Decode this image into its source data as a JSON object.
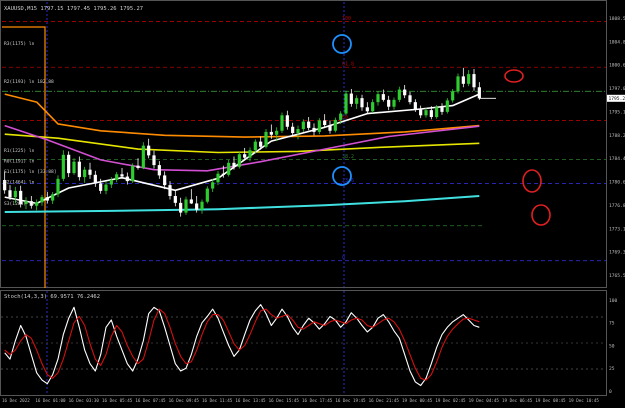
{
  "window": {
    "header_text": "XAUUSD,M15  1797.15 1797.45 1795.26 1795.27",
    "indicator_header": "Stoch(14,3,3) 69.9571 76.2462"
  },
  "colors": {
    "background": "#000000",
    "bull_candle": "#2ecc2e",
    "bear_candle": "#ffffff",
    "ema_orange": "#ff8c00",
    "ema_yellow": "#e6e600",
    "ema_pink": "#d24fd2",
    "ema_white": "#ffffff",
    "ema_cyan": "#40e0e0",
    "fib_red": "#b00000",
    "fib_green": "#2a7a2a",
    "fib_blue": "#2b2bcc",
    "stoch_main": "#ffffff",
    "stoch_signal": "#d41010",
    "annotation_blue": "#1e90ff",
    "annotation_red": "#e02020"
  },
  "chart_data": [
    {
      "type": "candlestick",
      "symbol": "XAUUSD",
      "timeframe": "M15",
      "ylim": [
        1763,
        1810
      ],
      "price_axis_labels": [
        "1808.56",
        "1804.88",
        "1800.65",
        "1797.04",
        "1795.12",
        "1788.21",
        "1784.44",
        "1780.65",
        "1776.88",
        "1773.11",
        "1769.34",
        "1765.57"
      ],
      "current_price": "1795.27",
      "time_labels": [
        "16 Dec 2022",
        "16 Dec 01:00",
        "16 Dec 03:30",
        "16 Dec 05:45",
        "16 Dec 07:45",
        "16 Dec 09:45",
        "16 Dec 11:45",
        "16 Dec 13:45",
        "16 Dec 15:45",
        "16 Dec 17:45",
        "16 Dec 19:45",
        "16 Dec 21:45",
        "19 Dec 00:45",
        "19 Dec 02:45",
        "19 Dec 04:45",
        "19 Dec 06:45",
        "19 Dec 08:45",
        "19 Dec 10:45"
      ],
      "candles": [
        [
          1781.0,
          1782.5,
          1778.6,
          1779.2
        ],
        [
          1779.2,
          1780.1,
          1777.5,
          1778.0
        ],
        [
          1778.0,
          1779.8,
          1776.9,
          1779.1
        ],
        [
          1779.1,
          1780.0,
          1776.2,
          1776.8
        ],
        [
          1776.8,
          1778.0,
          1775.9,
          1777.3
        ],
        [
          1777.3,
          1778.2,
          1776.0,
          1776.5
        ],
        [
          1776.5,
          1777.6,
          1775.7,
          1777.1
        ],
        [
          1777.1,
          1778.4,
          1776.5,
          1778.0
        ],
        [
          1778.0,
          1778.9,
          1776.9,
          1777.4
        ],
        [
          1777.4,
          1778.9,
          1776.8,
          1778.5
        ],
        [
          1778.5,
          1781.8,
          1778.0,
          1781.2
        ],
        [
          1781.2,
          1786.2,
          1780.8,
          1785.4
        ],
        [
          1785.4,
          1786.0,
          1781.5,
          1782.2
        ],
        [
          1782.2,
          1784.8,
          1781.9,
          1784.2
        ],
        [
          1784.2,
          1785.1,
          1780.9,
          1781.5
        ],
        [
          1781.5,
          1783.3,
          1780.5,
          1782.8
        ],
        [
          1782.8,
          1784.0,
          1781.2,
          1781.9
        ],
        [
          1781.9,
          1782.6,
          1779.8,
          1780.4
        ],
        [
          1780.4,
          1781.2,
          1778.6,
          1779.1
        ],
        [
          1779.1,
          1780.7,
          1778.5,
          1780.2
        ],
        [
          1780.2,
          1781.5,
          1779.6,
          1781.0
        ],
        [
          1781.0,
          1782.4,
          1780.6,
          1782.0
        ],
        [
          1782.0,
          1783.1,
          1781.2,
          1781.6
        ],
        [
          1781.6,
          1782.3,
          1780.2,
          1780.8
        ],
        [
          1780.8,
          1783.9,
          1780.5,
          1783.5
        ],
        [
          1783.5,
          1784.8,
          1782.8,
          1783.1
        ],
        [
          1783.1,
          1787.6,
          1782.9,
          1787.0
        ],
        [
          1787.0,
          1788.2,
          1784.8,
          1785.3
        ],
        [
          1785.3,
          1786.1,
          1783.0,
          1783.6
        ],
        [
          1783.6,
          1784.3,
          1781.2,
          1781.8
        ],
        [
          1781.8,
          1782.5,
          1779.4,
          1780.1
        ],
        [
          1780.1,
          1780.8,
          1777.6,
          1778.2
        ],
        [
          1778.2,
          1779.1,
          1776.4,
          1777.0
        ],
        [
          1777.0,
          1777.9,
          1774.6,
          1775.3
        ],
        [
          1775.3,
          1778.1,
          1774.9,
          1777.6
        ],
        [
          1777.6,
          1779.4,
          1776.8,
          1776.9
        ],
        [
          1776.9,
          1778.2,
          1775.3,
          1775.8
        ],
        [
          1775.8,
          1777.6,
          1775.1,
          1777.2
        ],
        [
          1777.2,
          1779.9,
          1776.9,
          1779.5
        ],
        [
          1779.5,
          1781.2,
          1778.9,
          1780.6
        ],
        [
          1780.6,
          1782.6,
          1780.1,
          1782.1
        ],
        [
          1782.1,
          1783.5,
          1781.4,
          1781.9
        ],
        [
          1781.9,
          1784.5,
          1781.6,
          1784.0
        ],
        [
          1784.0,
          1785.1,
          1782.8,
          1783.3
        ],
        [
          1783.3,
          1785.9,
          1783.0,
          1785.5
        ],
        [
          1785.5,
          1786.6,
          1784.4,
          1784.9
        ],
        [
          1784.9,
          1786.7,
          1784.3,
          1786.2
        ],
        [
          1786.2,
          1788.1,
          1785.6,
          1787.7
        ],
        [
          1787.7,
          1788.6,
          1786.3,
          1786.8
        ],
        [
          1786.8,
          1789.9,
          1786.5,
          1789.4
        ],
        [
          1789.4,
          1790.7,
          1788.2,
          1788.9
        ],
        [
          1788.9,
          1790.2,
          1787.8,
          1789.6
        ],
        [
          1789.6,
          1792.8,
          1789.2,
          1792.3
        ],
        [
          1792.3,
          1793.1,
          1789.8,
          1790.3
        ],
        [
          1790.3,
          1791.0,
          1788.6,
          1789.2
        ],
        [
          1789.2,
          1790.5,
          1788.1,
          1789.9
        ],
        [
          1789.9,
          1791.6,
          1789.4,
          1791.2
        ],
        [
          1791.2,
          1792.0,
          1789.7,
          1790.1
        ],
        [
          1790.1,
          1790.9,
          1788.8,
          1789.4
        ],
        [
          1789.4,
          1791.8,
          1789.0,
          1791.4
        ],
        [
          1791.4,
          1792.5,
          1790.2,
          1790.6
        ],
        [
          1790.6,
          1791.4,
          1789.1,
          1789.6
        ],
        [
          1789.6,
          1791.9,
          1789.3,
          1791.5
        ],
        [
          1791.5,
          1793.0,
          1790.8,
          1792.6
        ],
        [
          1792.6,
          1796.6,
          1792.3,
          1796.1
        ],
        [
          1796.1,
          1796.9,
          1793.8,
          1794.3
        ],
        [
          1794.3,
          1795.8,
          1793.4,
          1795.3
        ],
        [
          1795.3,
          1795.9,
          1793.1,
          1793.7
        ],
        [
          1793.7,
          1794.6,
          1792.5,
          1793.0
        ],
        [
          1793.0,
          1795.1,
          1792.7,
          1794.6
        ],
        [
          1794.6,
          1796.5,
          1794.0,
          1796.0
        ],
        [
          1796.0,
          1796.8,
          1794.7,
          1795.0
        ],
        [
          1795.0,
          1795.7,
          1793.2,
          1793.8
        ],
        [
          1793.8,
          1795.4,
          1793.3,
          1795.0
        ],
        [
          1795.0,
          1797.3,
          1794.6,
          1796.8
        ],
        [
          1796.8,
          1797.6,
          1795.3,
          1795.8
        ],
        [
          1795.8,
          1796.4,
          1794.2,
          1794.6
        ],
        [
          1794.6,
          1795.1,
          1792.9,
          1793.3
        ],
        [
          1793.3,
          1794.0,
          1791.8,
          1792.3
        ],
        [
          1792.3,
          1793.6,
          1791.9,
          1793.2
        ],
        [
          1793.2,
          1793.9,
          1791.6,
          1792.0
        ],
        [
          1792.0,
          1794.1,
          1791.7,
          1793.7
        ],
        [
          1793.7,
          1794.4,
          1792.4,
          1792.9
        ],
        [
          1792.9,
          1795.3,
          1792.6,
          1794.9
        ],
        [
          1794.9,
          1796.9,
          1794.5,
          1796.5
        ],
        [
          1796.5,
          1799.6,
          1796.1,
          1799.1
        ],
        [
          1799.1,
          1800.6,
          1797.2,
          1797.8
        ],
        [
          1797.8,
          1800.2,
          1797.4,
          1799.5
        ],
        [
          1799.5,
          1800.4,
          1796.6,
          1797.2
        ],
        [
          1797.2,
          1798.1,
          1795.0,
          1795.27
        ]
      ],
      "moving_averages": [
        {
          "name": "EMA orange",
          "color_key": "ema_orange",
          "points": [
            [
              0,
              1796.0
            ],
            [
              6,
              1794.6
            ],
            [
              10,
              1790.8
            ],
            [
              18,
              1789.6
            ],
            [
              30,
              1788.8
            ],
            [
              45,
              1788.5
            ],
            [
              60,
              1788.7
            ],
            [
              75,
              1789.4
            ],
            [
              89,
              1790.5
            ]
          ]
        },
        {
          "name": "EMA yellow",
          "color_key": "ema_yellow",
          "points": [
            [
              0,
              1789.0
            ],
            [
              10,
              1788.3
            ],
            [
              25,
              1786.4
            ],
            [
              40,
              1785.8
            ],
            [
              55,
              1786.0
            ],
            [
              70,
              1786.7
            ],
            [
              89,
              1787.4
            ]
          ]
        },
        {
          "name": "EMA pink",
          "color_key": "ema_pink",
          "points": [
            [
              0,
              1790.5
            ],
            [
              8,
              1788.0
            ],
            [
              18,
              1784.5
            ],
            [
              28,
              1782.8
            ],
            [
              38,
              1782.6
            ],
            [
              48,
              1784.2
            ],
            [
              60,
              1786.4
            ],
            [
              72,
              1788.6
            ],
            [
              89,
              1790.4
            ]
          ]
        },
        {
          "name": "EMA white",
          "color_key": "ema_white",
          "points": [
            [
              0,
              1778.0
            ],
            [
              6,
              1776.9
            ],
            [
              12,
              1779.6
            ],
            [
              22,
              1781.4
            ],
            [
              32,
              1779.2
            ],
            [
              40,
              1781.3
            ],
            [
              50,
              1787.8
            ],
            [
              60,
              1790.2
            ],
            [
              68,
              1792.6
            ],
            [
              78,
              1793.4
            ],
            [
              84,
              1794.0
            ],
            [
              89,
              1796.0
            ]
          ]
        },
        {
          "name": "EMA cyan",
          "color_key": "ema_cyan",
          "points": [
            [
              0,
              1775.4
            ],
            [
              20,
              1775.6
            ],
            [
              40,
              1775.9
            ],
            [
              60,
              1776.6
            ],
            [
              75,
              1777.3
            ],
            [
              89,
              1778.2
            ]
          ]
        }
      ],
      "fib_levels": [
        {
          "label": "100",
          "price": 1808.7,
          "color_key": "fib_red"
        },
        {
          "label": "61.8",
          "price": 1800.7,
          "color_key": "fib_red"
        },
        {
          "label": "50",
          "price": 1791.4,
          "color_key": "fib_red"
        },
        {
          "label": "38.2",
          "price": 1784.6,
          "color_key": "fib_green"
        },
        {
          "label": "23.6",
          "price": 1780.4,
          "color_key": "fib_blue"
        },
        {
          "label": "0",
          "price": 1766.9,
          "color_key": "fib_blue"
        }
      ],
      "left_level_labels": [
        {
          "label": "R3(1175) ln",
          "price": 1804.9
        },
        {
          "label": "R2(1193) ln  182.88",
          "price": 1798.3
        },
        {
          "label": "R1(1225) ln",
          "price": 1786.2
        },
        {
          "label": "R0(1191) ln",
          "price": 1784.4
        },
        {
          "label": "S1(1175) ln  [33.88]",
          "price": 1782.5
        },
        {
          "label": "S2(1464) ln",
          "price": 1780.7
        },
        {
          "label": "S3(1203) ln",
          "price": 1776.9
        }
      ]
    },
    {
      "type": "line",
      "name": "Stochastic",
      "ylim": [
        0,
        100
      ],
      "axis_labels": [
        "100",
        "75",
        "50",
        "25",
        "0"
      ],
      "series": [
        {
          "name": "Stoch main",
          "color_key": "stoch_main",
          "values": [
            42,
            35,
            55,
            72,
            60,
            40,
            20,
            12,
            8,
            18,
            35,
            62,
            80,
            92,
            70,
            45,
            30,
            22,
            40,
            70,
            78,
            60,
            45,
            30,
            22,
            35,
            55,
            85,
            92,
            88,
            70,
            50,
            30,
            22,
            25,
            40,
            60,
            75,
            82,
            90,
            80,
            65,
            50,
            38,
            45,
            62,
            78,
            88,
            95,
            85,
            72,
            80,
            90,
            82,
            70,
            62,
            72,
            80,
            75,
            68,
            74,
            82,
            78,
            70,
            76,
            86,
            80,
            72,
            65,
            70,
            80,
            84,
            76,
            66,
            58,
            40,
            22,
            10,
            6,
            14,
            30,
            48,
            62,
            70,
            76,
            80,
            84,
            78,
            72,
            70
          ]
        },
        {
          "name": "Stoch signal",
          "color_key": "stoch_signal",
          "values": [
            45,
            40,
            45,
            55,
            62,
            58,
            45,
            30,
            18,
            14,
            20,
            35,
            55,
            75,
            82,
            72,
            52,
            35,
            28,
            40,
            60,
            72,
            65,
            50,
            38,
            30,
            35,
            55,
            78,
            90,
            85,
            70,
            52,
            38,
            30,
            32,
            45,
            62,
            76,
            84,
            84,
            78,
            65,
            52,
            45,
            50,
            62,
            76,
            88,
            90,
            84,
            80,
            82,
            84,
            78,
            70,
            68,
            72,
            76,
            74,
            72,
            76,
            78,
            76,
            74,
            78,
            80,
            78,
            72,
            70,
            74,
            78,
            80,
            76,
            68,
            55,
            40,
            25,
            14,
            12,
            18,
            32,
            48,
            60,
            68,
            74,
            79,
            80,
            78,
            76
          ]
        }
      ]
    }
  ],
  "annotations": {
    "circles": [
      {
        "name": "blue-circle-top",
        "color_key": "annotation_blue"
      },
      {
        "name": "blue-circle-mid",
        "color_key": "annotation_blue"
      },
      {
        "name": "red-circle-1",
        "color_key": "annotation_red"
      },
      {
        "name": "red-circle-2",
        "color_key": "annotation_red"
      },
      {
        "name": "red-circle-3",
        "color_key": "annotation_red"
      }
    ]
  }
}
